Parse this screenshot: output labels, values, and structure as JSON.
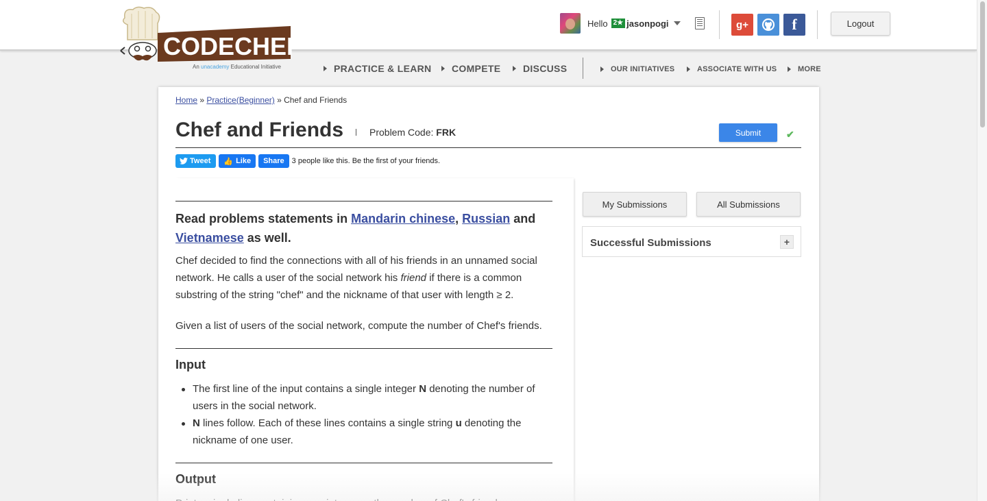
{
  "header": {
    "logo_text": "CODECHEF",
    "logo_sub_prefix": "An",
    "logo_sub_brand": "unacademy",
    "logo_sub_suffix": "Educational Initiative",
    "greeting": "Hello",
    "star_badge": "2★",
    "username": "jasonpogi",
    "social": {
      "gplus": "g+",
      "github": "github-icon",
      "facebook": "f"
    },
    "logout_label": "Logout"
  },
  "nav": {
    "main": [
      "PRACTICE & LEARN",
      "COMPETE",
      "DISCUSS"
    ],
    "secondary": [
      "OUR INITIATIVES",
      "ASSOCIATE WITH US",
      "MORE"
    ]
  },
  "breadcrumb": {
    "home": "Home",
    "sep1": " » ",
    "practice": "Practice(Beginner)",
    "sep2": " » ",
    "current": "Chef and Friends"
  },
  "problem": {
    "title": "Chef and Friends",
    "code_label": "Problem Code:",
    "code": "FRK",
    "submit_label": "Submit"
  },
  "share": {
    "tweet": "Tweet",
    "like": "Like",
    "share": "Share",
    "likes_text": "3 people like this. Be the first of your friends."
  },
  "statement": {
    "notice_prefix": "Read problems statements in",
    "lang1": "Mandarin chinese",
    "comma": ",",
    "lang2": "Russian",
    "and": "and",
    "lang3": "Vietnamese",
    "notice_suffix": "as well.",
    "para1_a": "Chef decided to find the connections with all of his friends in an unnamed social network. He calls a user of the social network his",
    "para1_em": "friend",
    "para1_b": "if there is a common substring of the string \"chef\" and the nickname of that user with length ≥ 2.",
    "para2": "Given a list of users of the social network, compute the number of Chef's friends.",
    "input_heading": "Input",
    "input_items": [
      {
        "a": "The first line of the input contains a single integer",
        "b": "N",
        "c": "denoting the number of users in the social network."
      },
      {
        "a": "",
        "b": "N",
        "c": "lines follow. Each of these lines contains a single string",
        "d": "u",
        "e": "denoting the nickname of one user."
      }
    ],
    "output_heading": "Output",
    "output_text": "Print a single line containing one integer — the number of Chef's friends."
  },
  "sidebar": {
    "my_submissions": "My Submissions",
    "all_submissions": "All Submissions",
    "successful_title": "Successful Submissions",
    "expand": "+"
  },
  "colors": {
    "accent_blue": "#3b86e8",
    "link": "#3a4ea0",
    "logo_brown": "#6b3a1f",
    "success_green": "#5cb85c"
  }
}
